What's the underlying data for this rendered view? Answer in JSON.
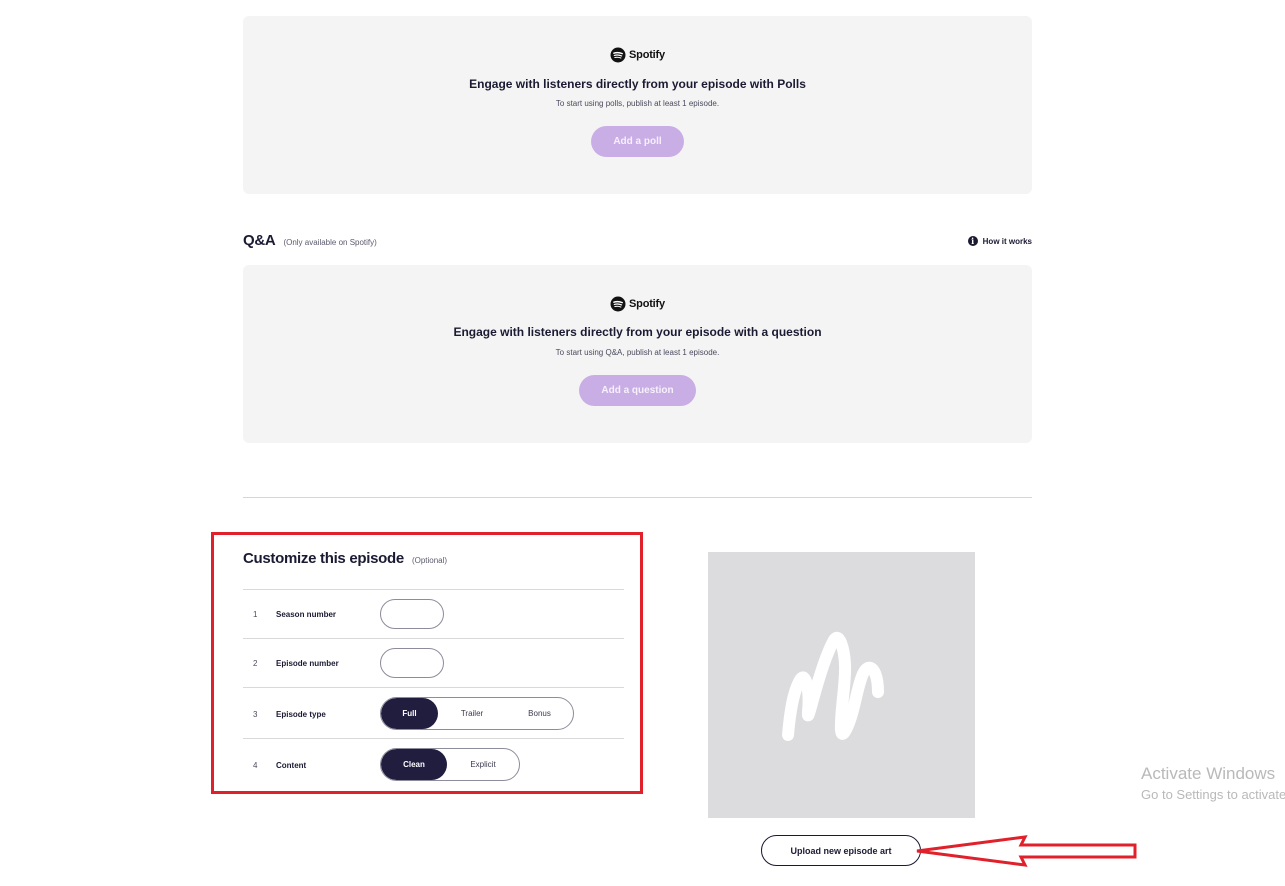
{
  "polls_card": {
    "brand": "Spotify",
    "title": "Engage with listeners directly from your episode with Polls",
    "subtitle": "To start using polls, publish at least 1 episode.",
    "button_label": "Add a poll"
  },
  "qa_section": {
    "heading": "Q&A",
    "note": "(Only available on Spotify)",
    "how_it_works": "How it works",
    "brand": "Spotify",
    "title": "Engage with listeners directly from your episode with a question",
    "subtitle": "To start using Q&A, publish at least 1 episode.",
    "button_label": "Add a question"
  },
  "customize": {
    "title": "Customize this episode",
    "optional": "(Optional)",
    "rows": [
      {
        "num": "1",
        "label": "Season number",
        "value": ""
      },
      {
        "num": "2",
        "label": "Episode number",
        "value": ""
      },
      {
        "num": "3",
        "label": "Episode type",
        "options": [
          "Full",
          "Trailer",
          "Bonus"
        ],
        "selected": "Full"
      },
      {
        "num": "4",
        "label": "Content",
        "options": [
          "Clean",
          "Explicit"
        ],
        "selected": "Clean"
      }
    ]
  },
  "episode_art": {
    "upload_label": "Upload new episode art"
  },
  "watermark": {
    "line1": "Activate Windows",
    "line2": "Go to Settings to activate Windows."
  },
  "colors": {
    "accent_purple": "#c9aee6",
    "dark_navy": "#211d3f",
    "highlight_red": "#e0202a"
  }
}
